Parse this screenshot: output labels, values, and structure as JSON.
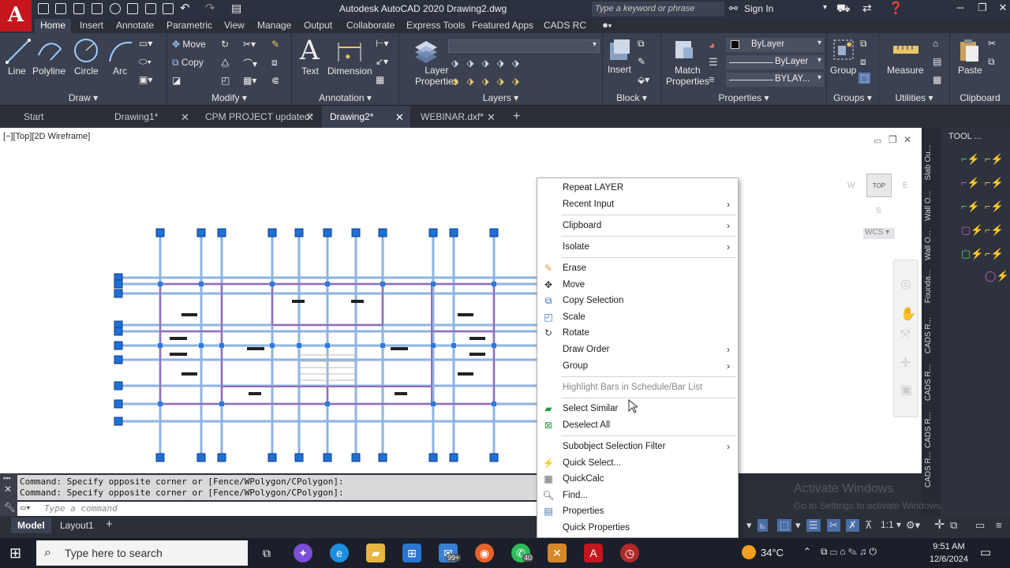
{
  "titlebar": {
    "logo": "A",
    "title": "Autodesk AutoCAD 2020   Drawing2.dwg",
    "search_placeholder": "Type a keyword or phrase",
    "sign_in": "Sign In"
  },
  "ribbon_tabs": [
    "Home",
    "Insert",
    "Annotate",
    "Parametric",
    "View",
    "Manage",
    "Output",
    "Collaborate",
    "Express Tools",
    "Featured Apps",
    "CADS RC"
  ],
  "ribbon": {
    "draw": {
      "title": "Draw",
      "line": "Line",
      "polyline": "Polyline",
      "circle": "Circle",
      "arc": "Arc"
    },
    "modify": {
      "title": "Modify",
      "move": "Move",
      "copy": "Copy"
    },
    "annotation": {
      "title": "Annotation",
      "text": "Text",
      "dimension": "Dimension"
    },
    "layers": {
      "title": "Layers",
      "layer_properties_1": "Layer",
      "layer_properties_2": "Properties"
    },
    "block": {
      "title": "Block",
      "insert": "Insert"
    },
    "properties": {
      "title": "Properties",
      "match_1": "Match",
      "match_2": "Properties",
      "color": "ByLayer",
      "linetype": "ByLayer",
      "lineweight": "BYLAY..."
    },
    "groups": {
      "title": "Groups",
      "group": "Group"
    },
    "utilities": {
      "title": "Utilities",
      "measure": "Measure"
    },
    "clipboard": {
      "title": "Clipboard",
      "paste": "Paste"
    }
  },
  "doc_tabs": [
    {
      "label": "Start"
    },
    {
      "label": "Drawing1*"
    },
    {
      "label": "CPM PROJECT updated*"
    },
    {
      "label": "Drawing2*"
    },
    {
      "label": "WEBINAR.dxf*"
    }
  ],
  "viewport_label": "[−][Top][2D Wireframe]",
  "viewcube": {
    "top": "TOP",
    "w": "W",
    "e": "E",
    "s": "S",
    "wcs": "WCS"
  },
  "context_menu": {
    "items": [
      {
        "label": "Repeat LAYER"
      },
      {
        "label": "Recent Input",
        "submenu": true
      },
      {
        "label": "Clipboard",
        "submenu": true
      },
      {
        "label": "Isolate",
        "submenu": true
      },
      {
        "label": "Erase",
        "icon": "eraser-icon"
      },
      {
        "label": "Move",
        "icon": "move-icon"
      },
      {
        "label": "Copy Selection",
        "icon": "copy-icon"
      },
      {
        "label": "Scale",
        "icon": "scale-icon"
      },
      {
        "label": "Rotate",
        "icon": "rotate-icon"
      },
      {
        "label": "Draw Order",
        "submenu": true
      },
      {
        "label": "Group",
        "submenu": true
      },
      {
        "label": "Highlight Bars in Schedule/Bar List",
        "disabled": true
      },
      {
        "label": "Select Similar",
        "icon": "select-similar-icon"
      },
      {
        "label": "Deselect All",
        "icon": "deselect-icon"
      },
      {
        "label": "Subobject Selection Filter",
        "submenu": true
      },
      {
        "label": "Quick Select...",
        "icon": "quick-select-icon"
      },
      {
        "label": "QuickCalc",
        "icon": "calculator-icon"
      },
      {
        "label": "Find...",
        "icon": "find-icon"
      },
      {
        "label": "Properties",
        "icon": "properties-icon"
      },
      {
        "label": "Quick Properties"
      }
    ]
  },
  "palette": {
    "title": "TOOL ...",
    "vertical_labels": [
      "Slab Ou...",
      "Wall O...",
      "Wall O...",
      "Founda...",
      "CADS R...",
      "CADS R...",
      "CADS R...",
      "CADS R..."
    ]
  },
  "command": {
    "history": [
      "Command: Specify opposite corner or [Fence/WPolygon/CPolygon]:",
      "Command: Specify opposite corner or [Fence/WPolygon/CPolygon]:"
    ],
    "placeholder": "Type a command"
  },
  "layout_tabs": [
    "Model",
    "Layout1"
  ],
  "status": {
    "scale": "1:1"
  },
  "watermark": {
    "line1": "Activate Windows",
    "line2": "Go to Settings to activate Windows."
  },
  "taskbar": {
    "search_placeholder": "Type here to search",
    "badge_mail": "99+",
    "badge_whatsapp": "40",
    "temperature": "34°C",
    "time": "9:51 AM",
    "date": "12/6/2024"
  }
}
